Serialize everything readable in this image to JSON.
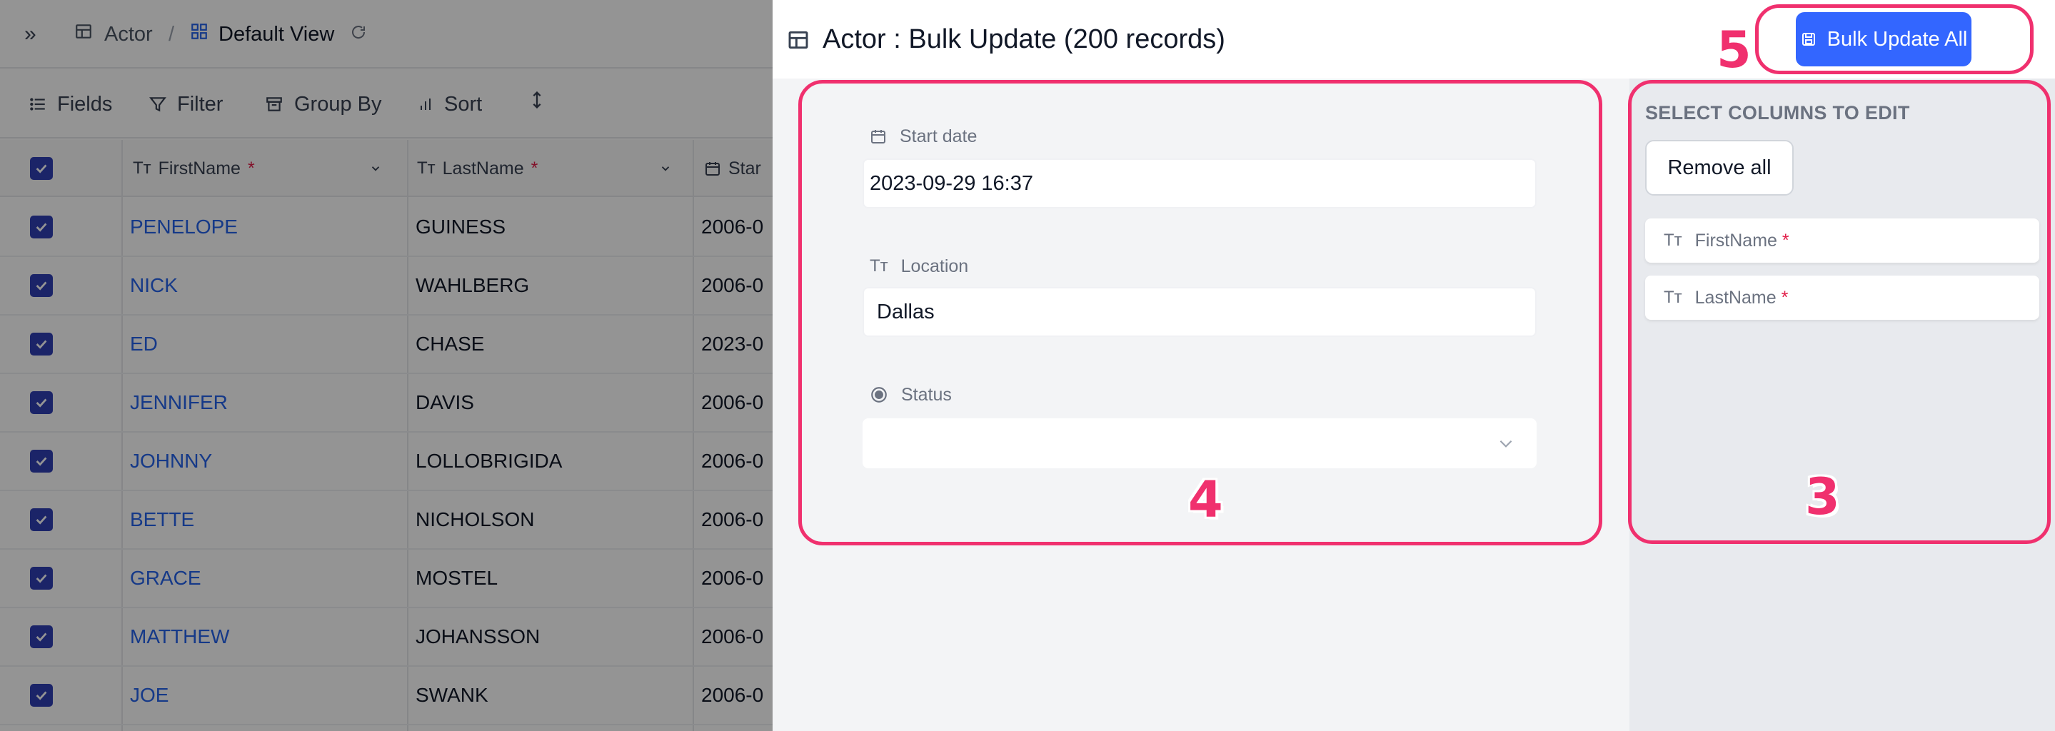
{
  "breadcrumb": {
    "expand_icon": "double-chevron-right-icon",
    "table": "Actor",
    "separator": "/",
    "view": "Default View"
  },
  "toolbar": {
    "fields": "Fields",
    "filter": "Filter",
    "group_by": "Group By",
    "sort": "Sort"
  },
  "grid": {
    "columns": [
      {
        "label": "FirstName",
        "required": "*"
      },
      {
        "label": "LastName",
        "required": "*"
      },
      {
        "label": "Star"
      }
    ],
    "rows": [
      {
        "first": "PENELOPE",
        "last": "GUINESS",
        "date": "2006-0"
      },
      {
        "first": "NICK",
        "last": "WAHLBERG",
        "date": "2006-0"
      },
      {
        "first": "ED",
        "last": "CHASE",
        "date": "2023-0"
      },
      {
        "first": "JENNIFER",
        "last": "DAVIS",
        "date": "2006-0"
      },
      {
        "first": "JOHNNY",
        "last": "LOLLOBRIGIDA",
        "date": "2006-0"
      },
      {
        "first": "BETTE",
        "last": "NICHOLSON",
        "date": "2006-0"
      },
      {
        "first": "GRACE",
        "last": "MOSTEL",
        "date": "2006-0"
      },
      {
        "first": "MATTHEW",
        "last": "JOHANSSON",
        "date": "2006-0"
      },
      {
        "first": "JOE",
        "last": "SWANK",
        "date": "2006-0"
      }
    ]
  },
  "drawer": {
    "title": "Actor : Bulk Update (200 records)",
    "bulk_update_label": "Bulk Update All",
    "fields": {
      "start_date": {
        "label": "Start date",
        "value": "2023-09-29 16:37"
      },
      "location": {
        "label": "Location",
        "value": "Dallas"
      },
      "status": {
        "label": "Status",
        "value": ""
      }
    },
    "side": {
      "title": "SELECT COLUMNS TO EDIT",
      "remove_all": "Remove all",
      "columns": [
        {
          "label": "FirstName",
          "required": "*"
        },
        {
          "label": "LastName",
          "required": "*"
        }
      ]
    }
  },
  "annotations": {
    "form": "4",
    "columns": "3",
    "button": "5"
  },
  "colors": {
    "accent": "#3366ff",
    "annotation": "#f0306e",
    "link": "#2563eb",
    "checkbox": "#2f3eb3"
  }
}
